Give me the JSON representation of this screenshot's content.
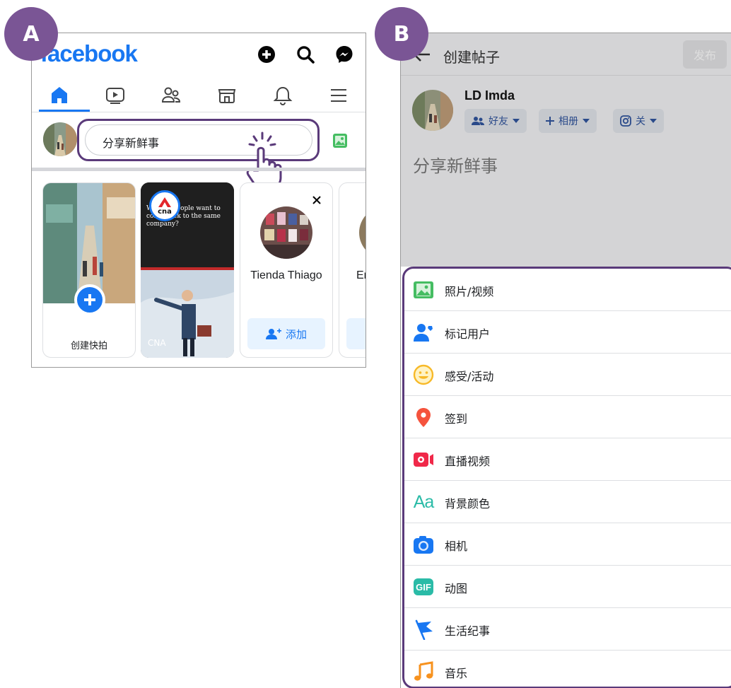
{
  "steps": {
    "a": "A",
    "b": "B"
  },
  "panel_a": {
    "logo": "facebook",
    "top_icons": [
      "plus-circle-icon",
      "search-icon",
      "messenger-icon"
    ],
    "nav": [
      "home-icon",
      "video-icon",
      "friends-icon",
      "marketplace-icon",
      "bell-icon",
      "menu-icon"
    ],
    "composer_placeholder": "分享新鲜事",
    "stories": {
      "create_label": "创建快拍",
      "cna_caption": "Why do people want to come back to the same company?",
      "cna_logo": "cna",
      "cna_label": "CNA",
      "suggest_name": "Tienda Thiago",
      "add_label": "添加",
      "partial_name": "Er"
    }
  },
  "panel_b": {
    "title": "创建帖子",
    "publish": "发布",
    "user_name": "LD Imda",
    "chips": {
      "audience": "好友",
      "album": "相册",
      "instagram": "关"
    },
    "placeholder": "分享新鲜事",
    "options": [
      {
        "label": "照片/视频",
        "icon": "photo-icon",
        "color": "#45bd62"
      },
      {
        "label": "标记用户",
        "icon": "tag-people-icon",
        "color": "#1877f2"
      },
      {
        "label": "感受/活动",
        "icon": "feeling-icon",
        "color": "#f7b928"
      },
      {
        "label": "签到",
        "icon": "check-in-icon",
        "color": "#f5533d"
      },
      {
        "label": "直播视频",
        "icon": "live-video-icon",
        "color": "#f02849"
      },
      {
        "label": "背景颜色",
        "icon": "background-color-icon",
        "color": "#2abba7"
      },
      {
        "label": "相机",
        "icon": "camera-icon",
        "color": "#1877f2"
      },
      {
        "label": "动图",
        "icon": "gif-icon",
        "color": "#2abba7"
      },
      {
        "label": "生活纪事",
        "icon": "life-event-icon",
        "color": "#1877f2"
      },
      {
        "label": "音乐",
        "icon": "music-icon",
        "color": "#f7921e"
      }
    ]
  }
}
